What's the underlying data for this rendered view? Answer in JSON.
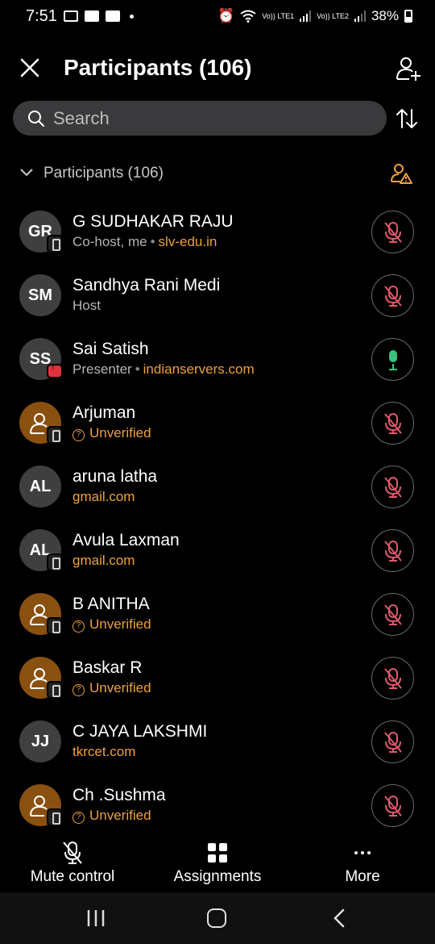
{
  "status_bar": {
    "time": "7:51",
    "net1": "Vo)) LTE1",
    "net2": "Vo)) LTE2",
    "battery": "38%"
  },
  "header": {
    "title": "Participants (106)",
    "close_icon": "close-icon",
    "add_icon": "add-person-icon"
  },
  "search": {
    "placeholder": "Search"
  },
  "section": {
    "title": "Participants (106)"
  },
  "participants": [
    {
      "initials": "GR",
      "name": "G SUDHAKAR RAJU",
      "role": "Co-host, me",
      "domain": "slv-edu.in",
      "badge": "device",
      "guest": false,
      "mic": "muted"
    },
    {
      "initials": "SM",
      "name": "Sandhya Rani Medi",
      "role": "Host",
      "domain": "",
      "badge": "none",
      "guest": false,
      "mic": "muted"
    },
    {
      "initials": "SS",
      "name": "Sai Satish",
      "role": "Presenter",
      "domain": "indianservers.com",
      "badge": "presenting",
      "guest": false,
      "mic": "active"
    },
    {
      "initials": "",
      "name": "Arjuman",
      "role": "",
      "domain": "",
      "unverified": "Unverified",
      "badge": "device",
      "guest": true,
      "mic": "muted"
    },
    {
      "initials": "AL",
      "name": "aruna latha",
      "role": "",
      "domain": "gmail.com",
      "badge": "none",
      "guest": false,
      "mic": "muted"
    },
    {
      "initials": "AL",
      "name": "Avula Laxman",
      "role": "",
      "domain": "gmail.com",
      "badge": "device",
      "guest": false,
      "mic": "muted"
    },
    {
      "initials": "",
      "name": "B ANITHA",
      "role": "",
      "domain": "",
      "unverified": "Unverified",
      "badge": "device",
      "guest": true,
      "mic": "muted"
    },
    {
      "initials": "",
      "name": "Baskar R",
      "role": "",
      "domain": "",
      "unverified": "Unverified",
      "badge": "device",
      "guest": true,
      "mic": "muted"
    },
    {
      "initials": "JJ",
      "name": "C JAYA LAKSHMI",
      "role": "",
      "domain": "tkrcet.com",
      "badge": "none",
      "guest": false,
      "mic": "muted"
    },
    {
      "initials": "",
      "name": "Ch .Sushma",
      "role": "",
      "domain": "",
      "unverified": "Unverified",
      "badge": "device",
      "guest": true,
      "mic": "muted"
    }
  ],
  "actions": {
    "mute_label": "Mute control",
    "assign_label": "Assignments",
    "more_label": "More"
  },
  "colors": {
    "accent_orange": "#f0a040",
    "mic_muted": "#e05a6a",
    "mic_active": "#3ec07a",
    "guest_avatar": "#8a5010"
  }
}
